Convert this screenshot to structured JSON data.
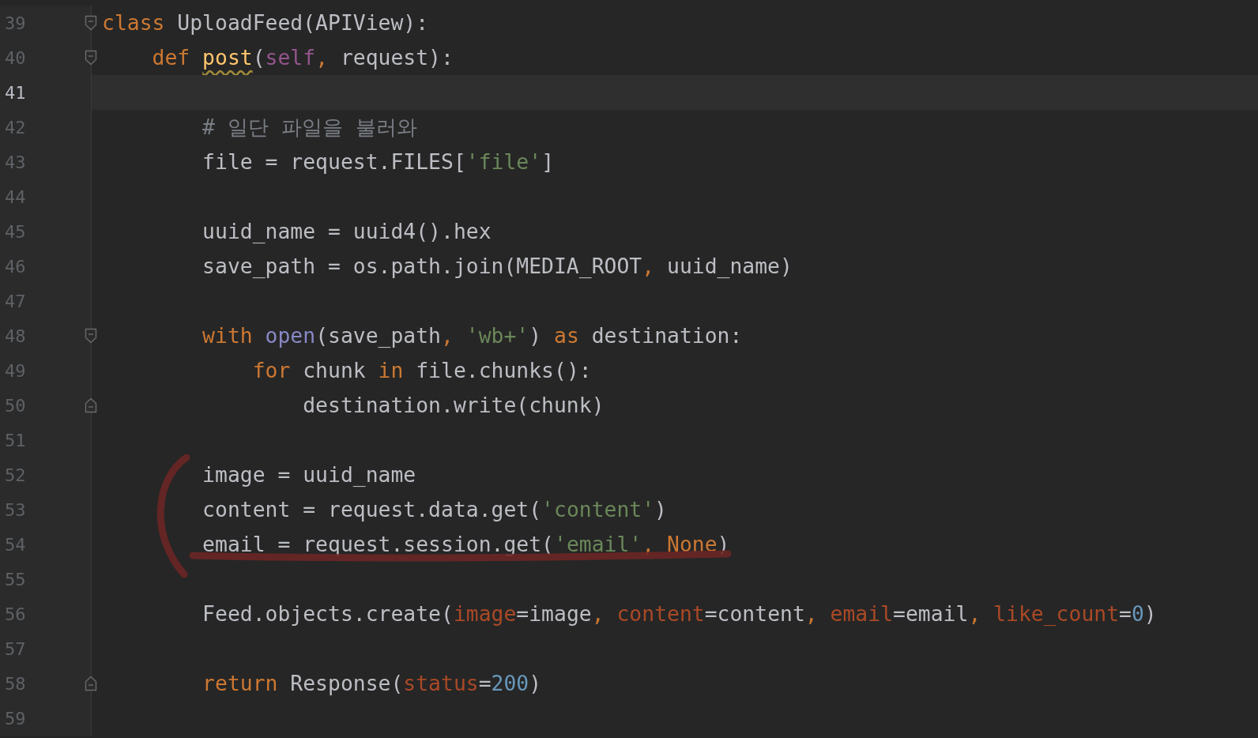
{
  "editor": {
    "lines": [
      {
        "number": "39",
        "current": false,
        "fold_start": true,
        "fold_end": false,
        "tokens": [
          {
            "text": "class",
            "kind": "keyword"
          },
          {
            "text": " UploadFeed(APIView):",
            "kind": "plain"
          }
        ]
      },
      {
        "number": "40",
        "current": false,
        "fold_start": true,
        "fold_end": false,
        "tokens": [
          {
            "text": "    def ",
            "kind": "keyword"
          },
          {
            "text": "post",
            "kind": "func-warning"
          },
          {
            "text": "(",
            "kind": "plain"
          },
          {
            "text": "self",
            "kind": "self"
          },
          {
            "text": ",",
            "kind": "keyword"
          },
          {
            "text": " request):",
            "kind": "plain"
          }
        ]
      },
      {
        "number": "41",
        "current": true,
        "fold_start": false,
        "fold_end": false
      },
      {
        "number": "42",
        "current": false,
        "fold_start": false,
        "fold_end": false,
        "tokens": [
          {
            "text": "        # 일단 파일을 불러와",
            "kind": "comment"
          }
        ]
      },
      {
        "number": "43",
        "current": false,
        "fold_start": false,
        "fold_end": false,
        "tokens": [
          {
            "text": "        file = request.FILES[",
            "kind": "plain"
          },
          {
            "text": "'file'",
            "kind": "string"
          },
          {
            "text": "]",
            "kind": "plain"
          }
        ]
      },
      {
        "number": "44",
        "current": false,
        "fold_start": false,
        "fold_end": false
      },
      {
        "number": "45",
        "current": false,
        "fold_start": false,
        "fold_end": false,
        "tokens": [
          {
            "text": "        uuid_name = uuid4().hex",
            "kind": "plain"
          }
        ]
      },
      {
        "number": "46",
        "current": false,
        "fold_start": false,
        "fold_end": false,
        "tokens": [
          {
            "text": "        save_path = os.path.join(MEDIA_ROOT",
            "kind": "plain"
          },
          {
            "text": ",",
            "kind": "keyword"
          },
          {
            "text": " uuid_name)",
            "kind": "plain"
          }
        ]
      },
      {
        "number": "47",
        "current": false,
        "fold_start": false,
        "fold_end": false
      },
      {
        "number": "48",
        "current": false,
        "fold_start": true,
        "fold_end": false,
        "tokens": [
          {
            "text": "        with ",
            "kind": "keyword"
          },
          {
            "text": "open",
            "kind": "builtin"
          },
          {
            "text": "(save_path",
            "kind": "plain"
          },
          {
            "text": ",",
            "kind": "keyword"
          },
          {
            "text": " 'wb+'",
            "kind": "string"
          },
          {
            "text": ") ",
            "kind": "plain"
          },
          {
            "text": "as",
            "kind": "keyword"
          },
          {
            "text": " destination:",
            "kind": "plain"
          }
        ]
      },
      {
        "number": "49",
        "current": false,
        "fold_start": false,
        "fold_end": false,
        "tokens": [
          {
            "text": "            for",
            "kind": "keyword"
          },
          {
            "text": " chunk ",
            "kind": "plain"
          },
          {
            "text": "in",
            "kind": "keyword"
          },
          {
            "text": " file.chunks():",
            "kind": "plain"
          }
        ]
      },
      {
        "number": "50",
        "current": false,
        "fold_start": false,
        "fold_end": true,
        "tokens": [
          {
            "text": "                destination.write(chunk)",
            "kind": "plain"
          }
        ]
      },
      {
        "number": "51",
        "current": false,
        "fold_start": false,
        "fold_end": false
      },
      {
        "number": "52",
        "current": false,
        "fold_start": false,
        "fold_end": false,
        "tokens": [
          {
            "text": "        image = uuid_name",
            "kind": "plain"
          }
        ]
      },
      {
        "number": "53",
        "current": false,
        "fold_start": false,
        "fold_end": false,
        "tokens": [
          {
            "text": "        content = request.data.get(",
            "kind": "plain"
          },
          {
            "text": "'content'",
            "kind": "string"
          },
          {
            "text": ")",
            "kind": "plain"
          }
        ]
      },
      {
        "number": "54",
        "current": false,
        "fold_start": false,
        "fold_end": false,
        "tokens": [
          {
            "text": "        email = request.session.get(",
            "kind": "plain"
          },
          {
            "text": "'email'",
            "kind": "string"
          },
          {
            "text": ", ",
            "kind": "keyword"
          },
          {
            "text": "None",
            "kind": "keyword"
          },
          {
            "text": ")",
            "kind": "plain"
          }
        ]
      },
      {
        "number": "55",
        "current": false,
        "fold_start": false,
        "fold_end": false
      },
      {
        "number": "56",
        "current": false,
        "fold_start": false,
        "fold_end": false,
        "tokens": [
          {
            "text": "        Feed.objects.create(",
            "kind": "plain"
          },
          {
            "text": "image",
            "kind": "param"
          },
          {
            "text": "=image",
            "kind": "plain"
          },
          {
            "text": ", ",
            "kind": "keyword"
          },
          {
            "text": "content",
            "kind": "param"
          },
          {
            "text": "=content",
            "kind": "plain"
          },
          {
            "text": ", ",
            "kind": "keyword"
          },
          {
            "text": "email",
            "kind": "param"
          },
          {
            "text": "=email",
            "kind": "plain"
          },
          {
            "text": ", ",
            "kind": "keyword"
          },
          {
            "text": "like_count",
            "kind": "param"
          },
          {
            "text": "=",
            "kind": "plain"
          },
          {
            "text": "0",
            "kind": "number"
          },
          {
            "text": ")",
            "kind": "plain"
          }
        ]
      },
      {
        "number": "57",
        "current": false,
        "fold_start": false,
        "fold_end": false
      },
      {
        "number": "58",
        "current": false,
        "fold_start": false,
        "fold_end": true,
        "tokens": [
          {
            "text": "        return",
            "kind": "keyword"
          },
          {
            "text": " Response(",
            "kind": "plain"
          },
          {
            "text": "status",
            "kind": "param"
          },
          {
            "text": "=",
            "kind": "plain"
          },
          {
            "text": "200",
            "kind": "number"
          },
          {
            "text": ")",
            "kind": "plain"
          }
        ]
      },
      {
        "number": "59",
        "current": false,
        "fold_start": false,
        "fold_end": false
      }
    ]
  }
}
